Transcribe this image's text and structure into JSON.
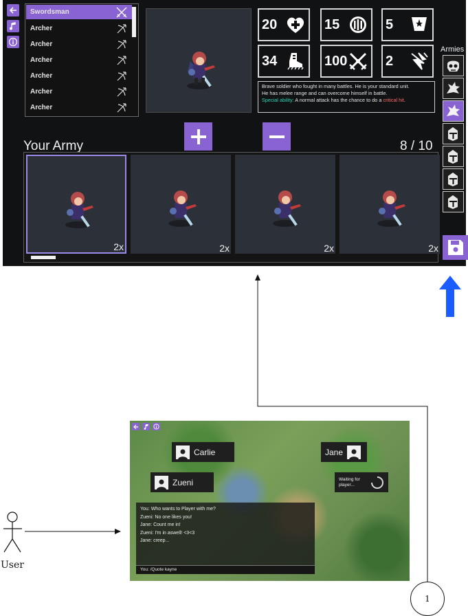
{
  "top_screen": {
    "nav_icons": [
      "back-arrow-icon",
      "music-note-icon",
      "info-icon"
    ],
    "unit_list": [
      {
        "label": "Swordsman",
        "icon": "crossed-swords-icon",
        "selected": true
      },
      {
        "label": "Archer",
        "icon": "bow-arrow-icon",
        "selected": false
      },
      {
        "label": "Archer",
        "icon": "bow-arrow-icon",
        "selected": false
      },
      {
        "label": "Archer",
        "icon": "bow-arrow-icon",
        "selected": false
      },
      {
        "label": "Archer",
        "icon": "bow-arrow-icon",
        "selected": false
      },
      {
        "label": "Archer",
        "icon": "bow-arrow-icon",
        "selected": false
      },
      {
        "label": "Archer",
        "icon": "bow-arrow-icon",
        "selected": false
      }
    ],
    "stats": [
      {
        "value": "20",
        "icon": "health-heart-icon"
      },
      {
        "value": "15",
        "icon": "armor-shield-icon"
      },
      {
        "value": "5",
        "icon": "magic-pentagram-icon"
      },
      {
        "value": "34",
        "icon": "speed-boot-icon"
      },
      {
        "value": "100",
        "icon": "attack-swords-icon"
      },
      {
        "value": "2",
        "icon": "critical-claw-icon"
      }
    ],
    "description": {
      "line1": "Brave soldier who fought in many battles. He is your standard unit.",
      "line2": "He has melee range and can overcome himself in battle.",
      "special_label": "Special ability:",
      "special_text": " A normal attack has the chance to do a ",
      "special_highlight": "critical hit",
      "special_end": "."
    },
    "add_label": "+",
    "remove_label": "−",
    "army_title": "Your Army",
    "army_count": "8 / 10",
    "army_slots": [
      {
        "qty": "2x",
        "selected": true
      },
      {
        "qty": "2x",
        "selected": false
      },
      {
        "qty": "2x",
        "selected": false
      },
      {
        "qty": "2x",
        "selected": false
      }
    ],
    "armies_label": "Armies",
    "army_icons": [
      "skull-helm-icon",
      "dragon-head-icon",
      "dragon-head-icon",
      "knight-helmet-icon",
      "knight-helmet-icon",
      "knight-helmet-icon",
      "knight-helmet-icon"
    ],
    "save_icon": "floppy-disk-icon",
    "colors": {
      "accent": "#8a63d2",
      "background": "#111214",
      "arrow_blue": "#1a5cff",
      "ability_green": "#2fd6b8",
      "crit_red": "#ff6b6b"
    }
  },
  "bottom_screen": {
    "players": [
      {
        "name": "Carlie"
      },
      {
        "name": "Jane"
      },
      {
        "name": "Zueni"
      }
    ],
    "waiting_text": [
      "Waiting for",
      "player..."
    ],
    "chat_lines": [
      "You:   Who wants to Player with me?",
      "Zueni: No one likes you!",
      "Jane:  Count me in!",
      "Zueni: I'm in aswell! <3<3",
      "Jane:  creep..."
    ],
    "chat_input": "You: /Quote kayne"
  },
  "diagram": {
    "actor_label": "User",
    "step_label": "1"
  }
}
